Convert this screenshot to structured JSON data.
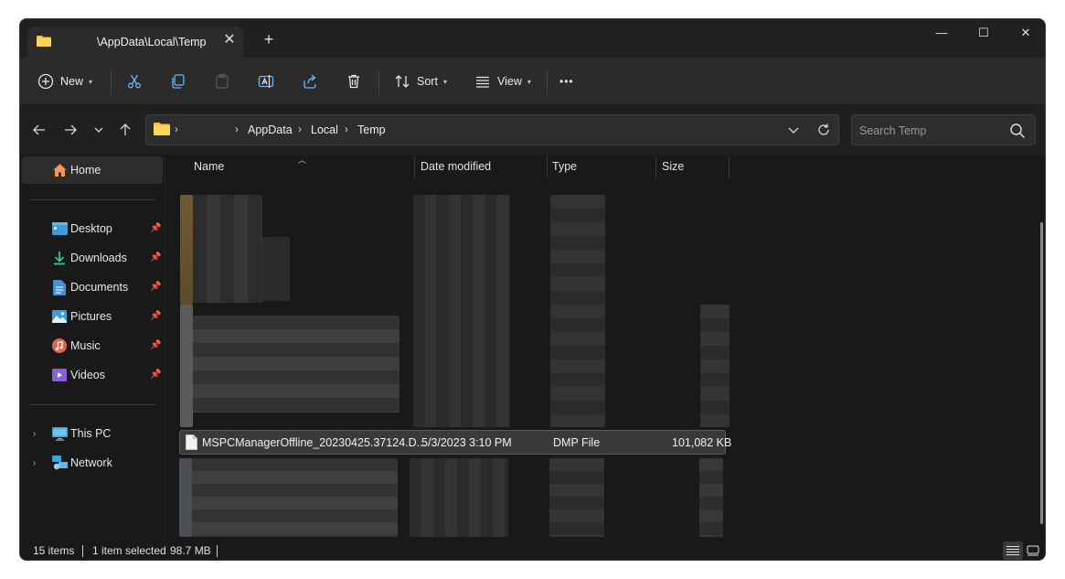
{
  "tab": {
    "title": "\\AppData\\Local\\Temp",
    "close": "✕",
    "new_tab": "+"
  },
  "window_controls": {
    "minimize": "—",
    "maximize": "☐",
    "close": "✕"
  },
  "toolbar": {
    "new_label": "New",
    "sort_label": "Sort",
    "view_label": "View",
    "more": "•••"
  },
  "address": {
    "root_chevron": "›",
    "crumbs": [
      "AppData",
      "Local",
      "Temp"
    ],
    "separator": "›"
  },
  "search": {
    "placeholder": "Search Temp"
  },
  "sidebar": {
    "home": "Home",
    "quick": [
      "Desktop",
      "Downloads",
      "Documents",
      "Pictures",
      "Music",
      "Videos"
    ],
    "this_pc": "This PC",
    "network": "Network",
    "expander": "›"
  },
  "columns": {
    "name": "Name",
    "date": "Date modified",
    "type": "Type",
    "size": "Size"
  },
  "selected_file": {
    "name": "MSPCManagerOffline_20230425.37124.D...",
    "date": "5/3/2023 3:10 PM",
    "type": "DMP File",
    "size": "101,082 KB"
  },
  "status": {
    "items": "15 items",
    "selection": "1 item selected",
    "size": "98.7 MB"
  },
  "colors": {
    "folder": "#f5c542",
    "accent": "#4cc2ff",
    "background": "#191919"
  }
}
